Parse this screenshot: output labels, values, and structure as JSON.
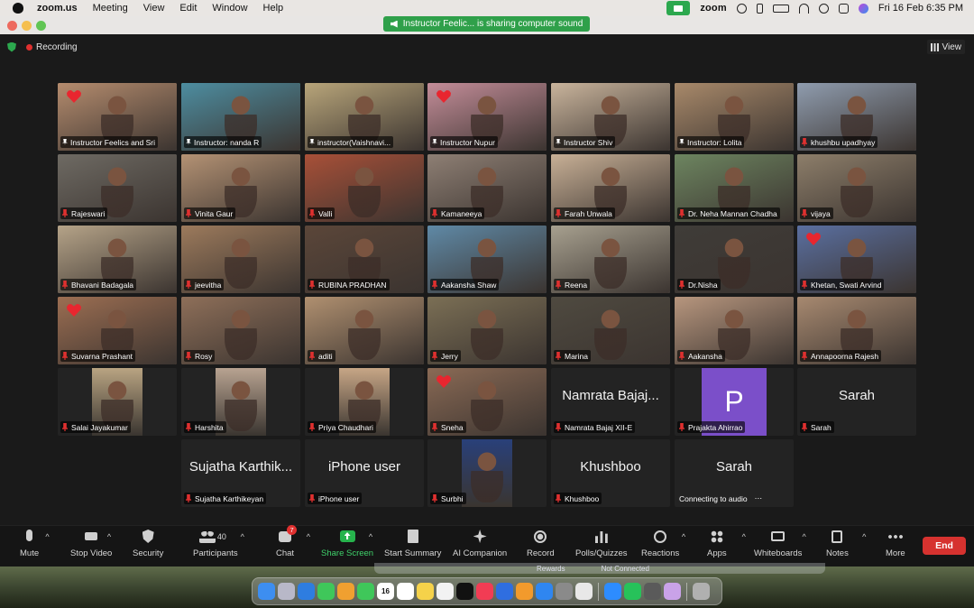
{
  "menubar": {
    "app_name": "zoom.us",
    "menus": [
      "Meeting",
      "View",
      "Edit",
      "Window",
      "Help"
    ],
    "zoom_label": "zoom",
    "clock": "Fri 16 Feb  6:35 PM"
  },
  "share_banner": "Instructor Feelic... is sharing computer sound",
  "meeting": {
    "recording_label": "Recording",
    "view_label": "View"
  },
  "tiles": [
    {
      "name": "Instructor Feelics and Sri",
      "pinned": true,
      "heart": true,
      "bg": "#b58c6e"
    },
    {
      "name": "Instructor: nanda R",
      "pinned": true,
      "active": true,
      "bg": "#4d8da0"
    },
    {
      "name": "instructor(Vaishnavi...",
      "pinned": true,
      "bg": "#b8a57a"
    },
    {
      "name": "Instructor Nupur",
      "pinned": true,
      "heart": true,
      "bg": "#c48d99"
    },
    {
      "name": "Instructor Shiv",
      "pinned": true,
      "bg": "#c9b49c"
    },
    {
      "name": "Instructor: Lolita",
      "pinned": true,
      "bg": "#a8896a"
    },
    {
      "name": "khushbu upadhyay",
      "bg": "#8f9cae"
    },
    {
      "name": "Rajeswari",
      "bg": "#6e6a63"
    },
    {
      "name": "Vinita Gaur",
      "bg": "#b49274"
    },
    {
      "name": "Valli",
      "bg": "#a85038"
    },
    {
      "name": "Kamaneeya",
      "bg": "#8e7f74"
    },
    {
      "name": "Farah Unwala",
      "bg": "#c8b096"
    },
    {
      "name": "Dr. Neha Mannan Chadha",
      "bg": "#6d8560"
    },
    {
      "name": "vijaya",
      "bg": "#8d7e6a"
    },
    {
      "name": "Bhavani Badagala",
      "bg": "#b5a388"
    },
    {
      "name": "jeevitha",
      "bg": "#9c7a5c"
    },
    {
      "name": "RUBINA PRADHAN",
      "bg": "#5b4639"
    },
    {
      "name": "Aakansha Shaw",
      "bg": "#5f89a6"
    },
    {
      "name": "Reena",
      "bg": "#a7a08f"
    },
    {
      "name": "Dr.Nisha",
      "bg": "#3f3c38"
    },
    {
      "name": "Khetan, Swati Arvind",
      "heart": true,
      "bg": "#5a6fa0"
    },
    {
      "name": "Suvarna Prashant",
      "heart": true,
      "bg": "#9c6e52"
    },
    {
      "name": "Rosy",
      "bg": "#8e6f59"
    },
    {
      "name": "aditi",
      "bg": "#b09070"
    },
    {
      "name": "Jerry",
      "bg": "#7b6f55"
    },
    {
      "name": "Marina",
      "bg": "#4f4a40"
    },
    {
      "name": "Aakansha",
      "bg": "#b7967e"
    },
    {
      "name": "Annapoorna Rajesh",
      "bg": "#a78970"
    },
    {
      "name": "Salai Jayakumar",
      "bg": "#232323",
      "inset": "#b9a482"
    },
    {
      "name": "Harshita",
      "bg": "#232323",
      "inset": "#b8a391"
    },
    {
      "name": "Priya Chaudhari",
      "bg": "#232323",
      "inset": "#c7a686"
    },
    {
      "name": "Sneha",
      "heart": true,
      "bg": "#8a6a55"
    },
    {
      "name": "Namrata Bajaj XII-E",
      "big": "Namrata Bajaj...",
      "bg": "#232323"
    },
    {
      "name": "Prajakta Ahirrao",
      "avatar": "P",
      "bg": "#232323"
    },
    {
      "name": "Sarah",
      "big": "Sarah",
      "bg": "#232323"
    },
    {
      "name": "Sujatha Karthikeyan",
      "big": "Sujatha Karthik...",
      "bg": "#232323"
    },
    {
      "name": "iPhone user",
      "big": "iPhone user",
      "bg": "#232323"
    },
    {
      "name": "Surbhi",
      "bg": "#232323",
      "inset": "#29407a"
    },
    {
      "name": "Khushboo",
      "big": "Khushboo",
      "bg": "#232323"
    },
    {
      "name": "Connecting to audio",
      "big": "Sarah",
      "nomute": true,
      "ellipsis": true,
      "bg": "#232323"
    }
  ],
  "toolbar": {
    "mute": "Mute",
    "stop_video": "Stop Video",
    "security": "Security",
    "participants": "Participants",
    "participants_count": "40",
    "chat": "Chat",
    "chat_badge": "7",
    "share_screen": "Share Screen",
    "start_summary": "Start Summary",
    "ai_companion": "AI Companion",
    "record": "Record",
    "polls": "Polls/Quizzes",
    "reactions": "Reactions",
    "apps": "Apps",
    "whiteboards": "Whiteboards",
    "notes": "Notes",
    "more": "More",
    "end": "End"
  },
  "background_window": {
    "left": "Rewards",
    "right": "Not Connected"
  },
  "dock": {
    "calendar_day": "16",
    "apps": [
      "finder-icon",
      "launchpad-icon",
      "safari-icon",
      "messages-icon",
      "photos-icon",
      "facetime-icon",
      "calendar-icon",
      "reminders-icon",
      "notes-icon",
      "freeform-icon",
      "tv-icon",
      "music-icon",
      "keynote-icon",
      "pages-icon",
      "appstore-icon",
      "settings-icon",
      "chrome-icon",
      "zoom-icon",
      "whatsapp-icon",
      "quicktime-icon",
      "preview-icon",
      "trash-icon"
    ]
  }
}
